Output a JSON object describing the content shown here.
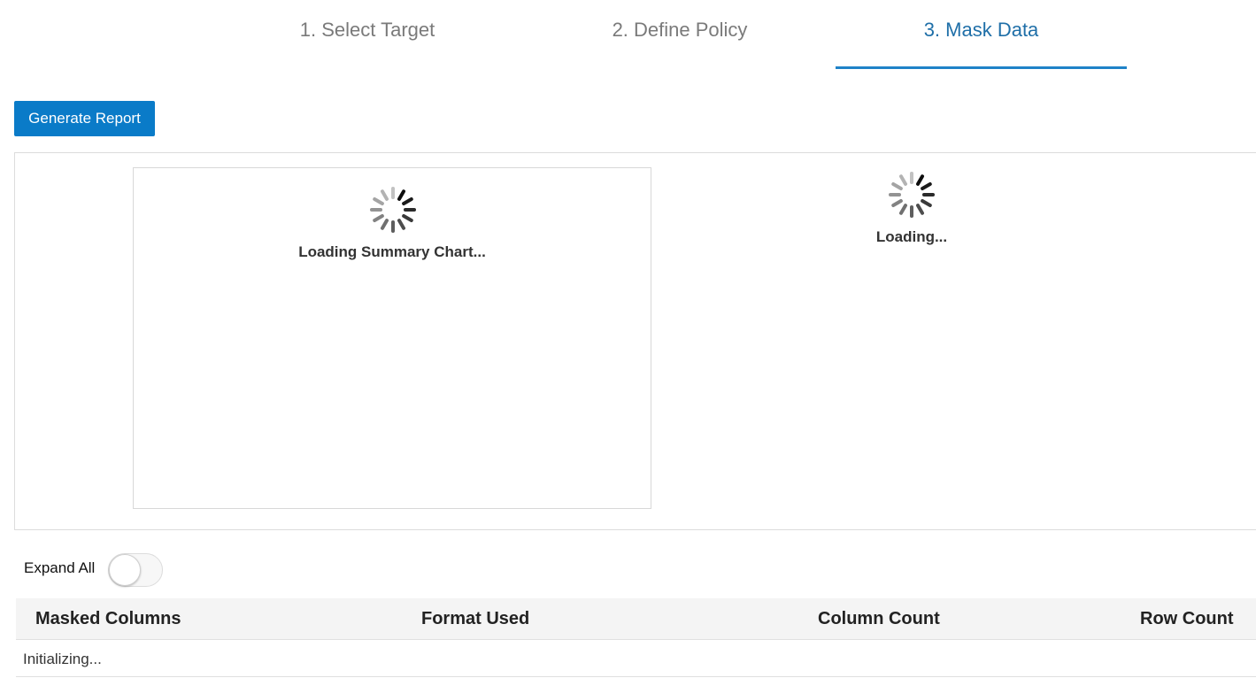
{
  "steps": [
    {
      "label": "1. Select Target",
      "active": false
    },
    {
      "label": "2. Define Policy",
      "active": false
    },
    {
      "label": "3. Mask Data",
      "active": true
    }
  ],
  "actions": {
    "generate_report": "Generate Report"
  },
  "report": {
    "summary_loading": "Loading Summary Chart...",
    "side_loading": "Loading..."
  },
  "expand_all": {
    "label": "Expand All",
    "enabled": false
  },
  "table": {
    "columns": [
      "Masked Columns",
      "Format Used",
      "Column Count",
      "Row Count"
    ],
    "status": "Initializing..."
  },
  "colors": {
    "accent": "#0a7bc8",
    "active_tab": "#1f6fa8",
    "inactive_tab": "#7a7a7a",
    "header_bg": "#f4f4f4"
  }
}
